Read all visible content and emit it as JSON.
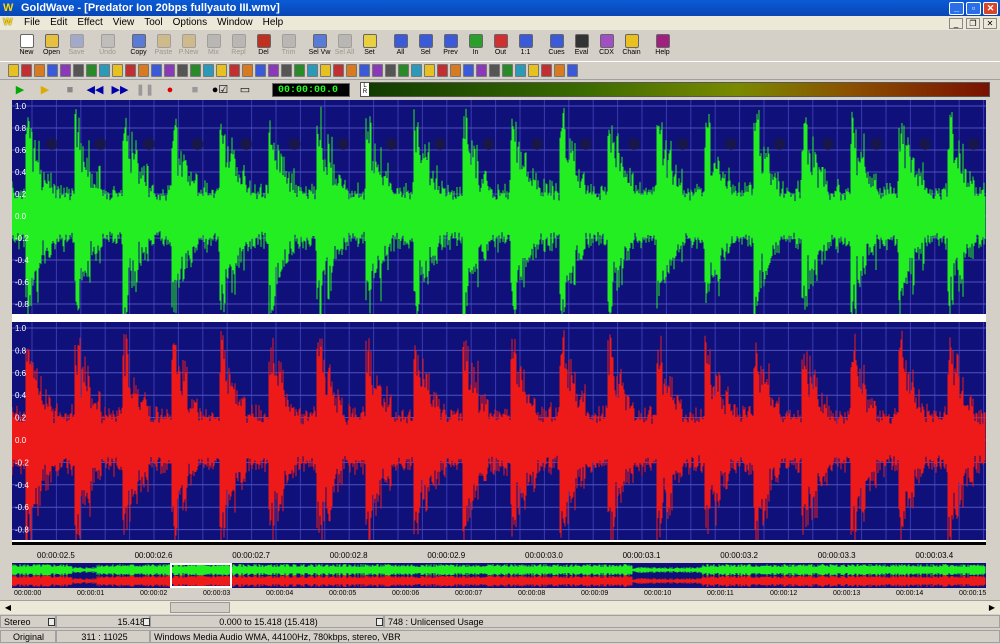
{
  "window": {
    "app_name": "GoldWave",
    "title": "GoldWave - [Predator Ion 20bps fullyauto III.wmv]"
  },
  "menu": [
    "File",
    "Edit",
    "Effect",
    "View",
    "Tool",
    "Options",
    "Window",
    "Help"
  ],
  "toolbar": [
    {
      "label": "New",
      "icon": "new-file-icon",
      "enabled": true
    },
    {
      "label": "Open",
      "icon": "open-folder-icon",
      "enabled": true
    },
    {
      "label": "Save",
      "icon": "save-icon",
      "enabled": false
    },
    {
      "label": "Undo",
      "icon": "undo-icon",
      "enabled": false
    },
    {
      "label": "Copy",
      "icon": "copy-icon",
      "enabled": true
    },
    {
      "label": "Paste",
      "icon": "paste-icon",
      "enabled": false
    },
    {
      "label": "P.New",
      "icon": "paste-new-icon",
      "enabled": false
    },
    {
      "label": "Mix",
      "icon": "mix-icon",
      "enabled": false
    },
    {
      "label": "Repl",
      "icon": "replace-icon",
      "enabled": false
    },
    {
      "label": "Del",
      "icon": "delete-icon",
      "enabled": true
    },
    {
      "label": "Trim",
      "icon": "trim-icon",
      "enabled": false
    },
    {
      "label": "Sel Vw",
      "icon": "select-view-icon",
      "enabled": true
    },
    {
      "label": "Sel All",
      "icon": "select-all-icon",
      "enabled": false
    },
    {
      "label": "Set",
      "icon": "set-icon",
      "enabled": true
    },
    {
      "label": "All",
      "icon": "zoom-all-icon",
      "enabled": true
    },
    {
      "label": "Sel",
      "icon": "zoom-selection-icon",
      "enabled": true
    },
    {
      "label": "Prev",
      "icon": "zoom-previous-icon",
      "enabled": true
    },
    {
      "label": "In",
      "icon": "zoom-in-icon",
      "enabled": true
    },
    {
      "label": "Out",
      "icon": "zoom-out-icon",
      "enabled": true
    },
    {
      "label": "1:1",
      "icon": "zoom-1to1-icon",
      "enabled": true
    },
    {
      "label": "Cues",
      "icon": "cues-icon",
      "enabled": true
    },
    {
      "label": "Eval",
      "icon": "eval-icon",
      "enabled": true
    },
    {
      "label": "CDX",
      "icon": "cdx-icon",
      "enabled": true
    },
    {
      "label": "Chain",
      "icon": "chain-icon",
      "enabled": true
    },
    {
      "label": "Help",
      "icon": "help-book-icon",
      "enabled": true
    }
  ],
  "transport": {
    "time": "00:00:00.0",
    "meter_lr": [
      "L",
      "R"
    ]
  },
  "channels": {
    "left": {
      "color": "#22ee22",
      "amp_labels": [
        "1.0",
        "0.8",
        "0.6",
        "0.4",
        "0.2",
        "0.0",
        "-0.2",
        "-0.4",
        "-0.6",
        "-0.8"
      ]
    },
    "right": {
      "color": "#ee1a1a",
      "amp_labels": [
        "1.0",
        "0.8",
        "0.6",
        "0.4",
        "0.2",
        "0.0",
        "-0.2",
        "-0.4",
        "-0.6",
        "-0.8"
      ]
    }
  },
  "timeline_labels": [
    "00:00:02.5",
    "00:00:02.6",
    "00:00:02.7",
    "00:00:02.8",
    "00:00:02.9",
    "00:00:03.0",
    "00:00:03.1",
    "00:00:03.2",
    "00:00:03.3",
    "00:00:03.4"
  ],
  "overview_labels": [
    "00:00:00",
    "00:00:01",
    "00:00:02",
    "00:00:03",
    "00:00:04",
    "00:00:05",
    "00:00:06",
    "00:00:07",
    "00:00:08",
    "00:00:09",
    "00:00:10",
    "00:00:11",
    "00:00:12",
    "00:00:13",
    "00:00:14",
    "00:00:15"
  ],
  "status": {
    "channels": "Stereo",
    "length": "15.418",
    "selection": "0.000 to 15.418 (15.418)",
    "license": "748 : Unlicensed Usage",
    "mode": "Original",
    "zoom": "311 : 11025",
    "format": "Windows Media Audio WMA, 44100Hz, 780kbps, stereo, VBR"
  }
}
